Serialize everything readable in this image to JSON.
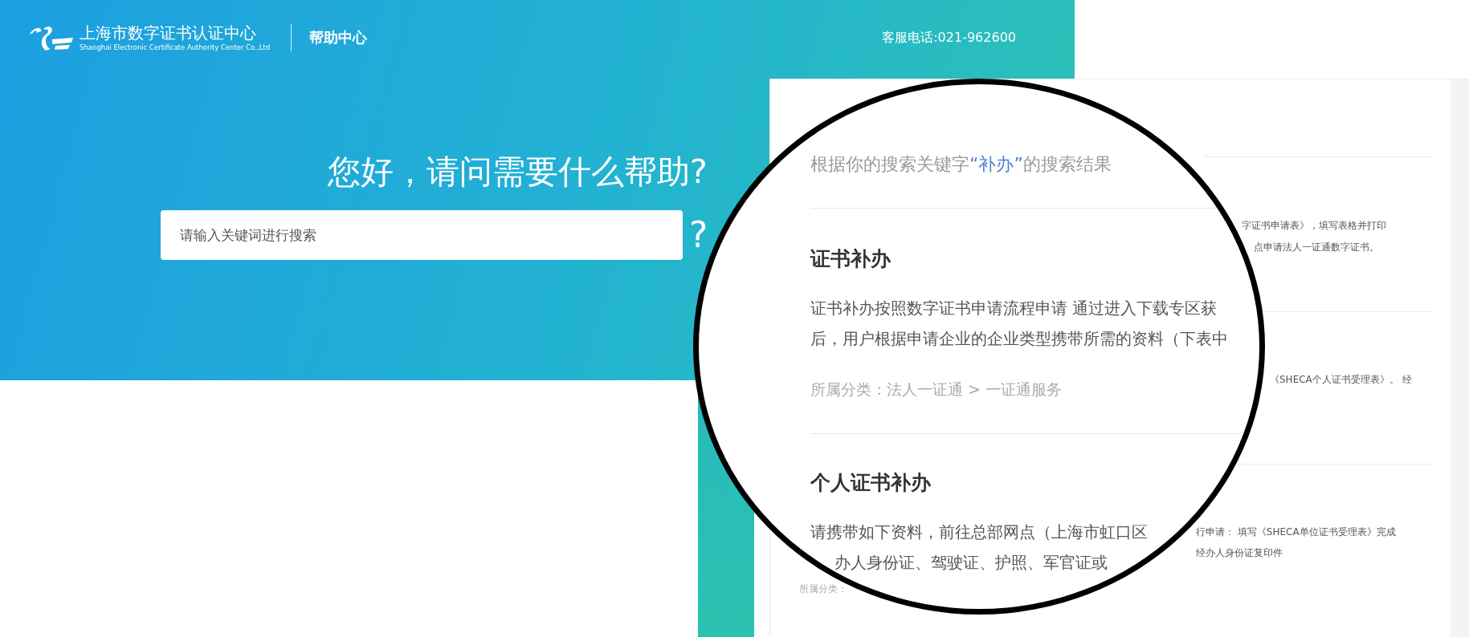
{
  "header": {
    "org_name": "上海市数字证书认证中心",
    "org_subtitle": "Shanghai Electronic Certificate Authority Center Co.,Ltd",
    "section": "帮助中心",
    "hotline": "客服电话:021-962600"
  },
  "hero": {
    "title": "您好，请问需要什么帮助?",
    "search": {
      "placeholder": "请输入关键词进行搜索"
    },
    "mark": "?"
  },
  "card_snippets": [
    "字证书申请表》，填写表格并打印",
    "点申请法人一证通数字证书。",
    "《SHECA个人证书受理表》。 经",
    "行申请： 填写《SHECA单位证书受理表》完成",
    "经办人身份证复印件"
  ],
  "card_category": "所属分类：",
  "magnifier": {
    "query": {
      "prefix": "根据你的搜索关键字",
      "keyword": "“补办”",
      "suffix": "的搜索结果"
    },
    "results": [
      {
        "title": "证书补办",
        "lines": [
          "证书补办按照数字证书申请流程申请 通过进入下载专区获",
          "后，用户根据申请企业的企业类型携带所需的资料（下表中"
        ],
        "category": "所属分类：法人一证通 > 一证通服务"
      },
      {
        "title": "个人证书补办",
        "lines": [
          "请携带如下资料，前往总部网点（上海市虹口区",
          "办人身份证、驾驶证、护照、军官证或"
        ]
      }
    ]
  }
}
